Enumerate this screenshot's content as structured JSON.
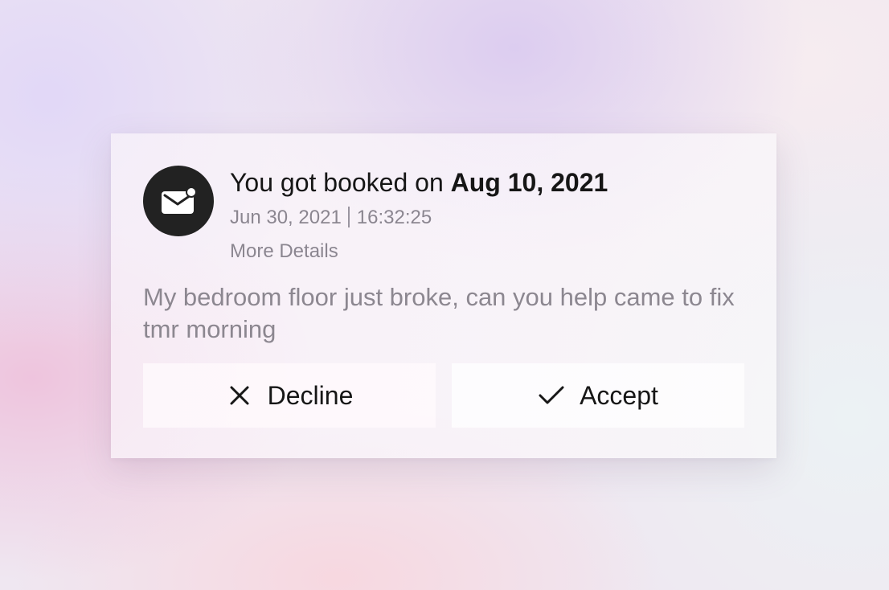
{
  "notification": {
    "icon": "mail-notification-icon",
    "title_prefix": "You got booked on",
    "title_date": "Aug 10, 2021",
    "meta_date": "Jun 30, 2021",
    "meta_time": "16:32:25",
    "more_details_label": "More Details",
    "message": "My bedroom floor just broke, can you help came to fix tmr morning"
  },
  "actions": {
    "decline_label": "Decline",
    "decline_icon": "close-icon",
    "accept_label": "Accept",
    "accept_icon": "checkmark-icon"
  },
  "colors": {
    "avatar_bg": "#222222",
    "text_primary": "#161616",
    "text_secondary": "#8b8690"
  }
}
